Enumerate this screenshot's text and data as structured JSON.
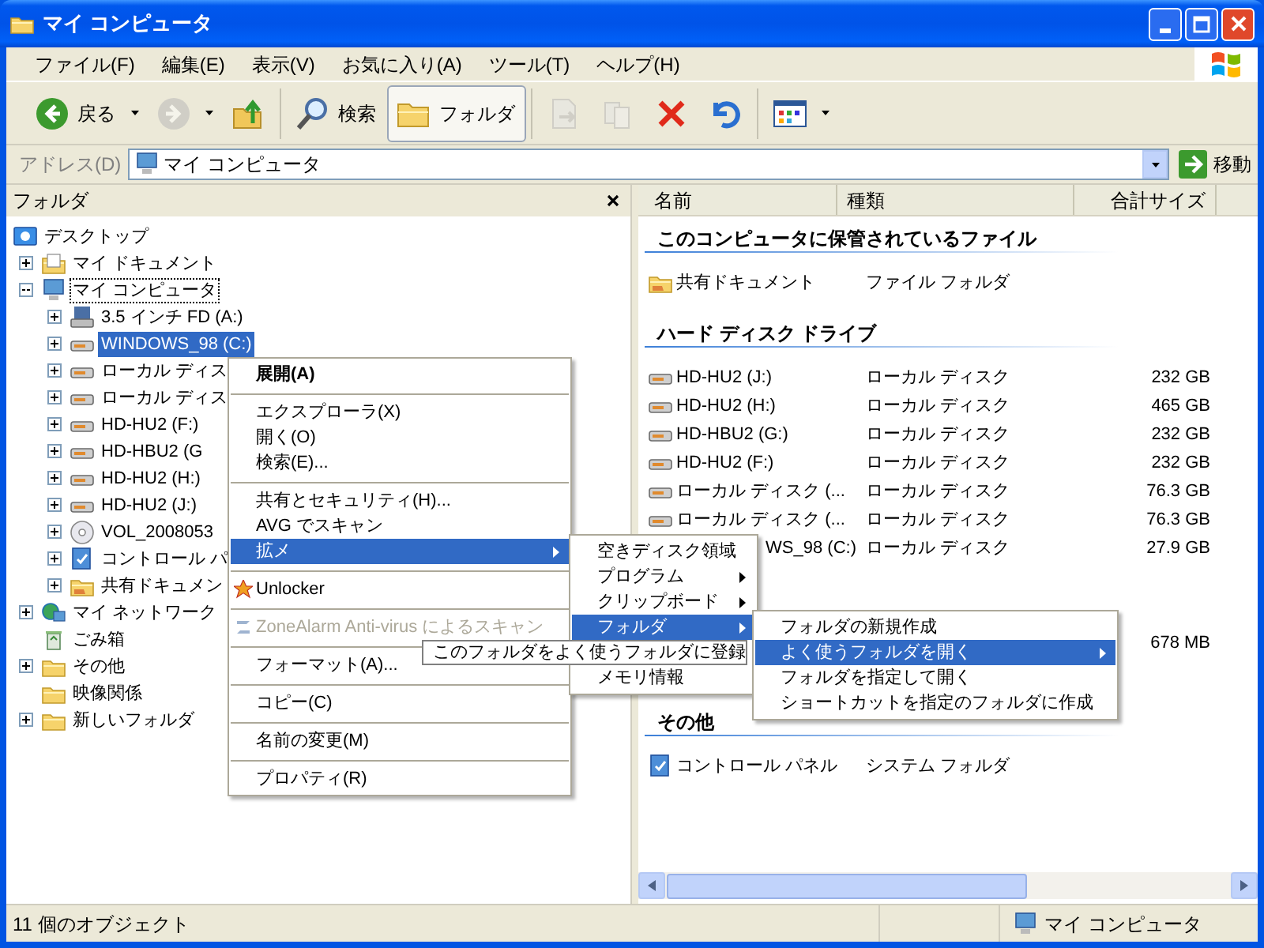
{
  "window": {
    "title": "マイ コンピュータ"
  },
  "menu_bar": [
    "ファイル(F)",
    "編集(E)",
    "表示(V)",
    "お気に入り(A)",
    "ツール(T)",
    "ヘルプ(H)"
  ],
  "toolbar": {
    "groups": [
      [
        {
          "kind": "back",
          "label": "戻る",
          "dropdown": true,
          "disabled": false,
          "selected": false
        },
        {
          "kind": "forward",
          "dropdown": true,
          "disabled": true,
          "selected": false
        },
        {
          "kind": "up",
          "dropdown": false,
          "disabled": false,
          "selected": false
        }
      ],
      [
        {
          "kind": "search",
          "label": "検索",
          "dropdown": false,
          "disabled": false,
          "selected": false
        },
        {
          "kind": "folders",
          "label": "フォルダ",
          "dropdown": false,
          "disabled": false,
          "selected": true
        }
      ],
      [
        {
          "kind": "move",
          "dropdown": false,
          "disabled": true,
          "selected": false
        },
        {
          "kind": "copy",
          "dropdown": false,
          "disabled": true,
          "selected": false
        },
        {
          "kind": "delete",
          "dropdown": false,
          "disabled": false,
          "selected": false
        },
        {
          "kind": "undo",
          "dropdown": false,
          "disabled": false,
          "selected": false
        }
      ],
      [
        {
          "kind": "views",
          "dropdown": true,
          "disabled": false,
          "selected": false
        }
      ]
    ]
  },
  "address": {
    "label": "アドレス(D)",
    "value": "マイ コンピュータ",
    "go_label": "移動"
  },
  "folders_pane": {
    "title": "フォルダ",
    "tree": [
      {
        "label": "デスクトップ",
        "kind": "desktop",
        "selected": false,
        "focused": false,
        "children": [
          {
            "label": "マイ ドキュメント",
            "kind": "documents",
            "expander": true,
            "expanded": false,
            "selected": false,
            "focused": false
          },
          {
            "label": "マイ コンピュータ",
            "kind": "computer",
            "expander": true,
            "expanded": true,
            "selected": false,
            "focused": true,
            "children": [
              {
                "label": "3.5 インチ FD (A:)",
                "kind": "floppy",
                "expander": true,
                "expanded": false,
                "selected": false,
                "focused": false
              },
              {
                "label": "WINDOWS_98 (C:)",
                "kind": "drive",
                "expander": true,
                "expanded": false,
                "selected": true,
                "focused": false
              },
              {
                "label": "ローカル ディス",
                "kind": "drive",
                "expander": true,
                "expanded": false,
                "selected": false,
                "focused": false
              },
              {
                "label": "ローカル ディス",
                "kind": "drive",
                "expander": true,
                "expanded": false,
                "selected": false,
                "focused": false
              },
              {
                "label": "HD-HU2 (F:)",
                "kind": "drive",
                "expander": true,
                "expanded": false,
                "selected": false,
                "focused": false
              },
              {
                "label": "HD-HBU2 (G",
                "kind": "drive",
                "expander": true,
                "expanded": false,
                "selected": false,
                "focused": false
              },
              {
                "label": "HD-HU2 (H:)",
                "kind": "drive",
                "expander": true,
                "expanded": false,
                "selected": false,
                "focused": false
              },
              {
                "label": "HD-HU2 (J:)",
                "kind": "drive",
                "expander": true,
                "expanded": false,
                "selected": false,
                "focused": false
              },
              {
                "label": "VOL_2008053",
                "kind": "cd",
                "expander": true,
                "expanded": false,
                "selected": false,
                "focused": false
              },
              {
                "label": "コントロール パ",
                "kind": "control-panel",
                "expander": true,
                "expanded": false,
                "selected": false,
                "focused": false
              },
              {
                "label": "共有ドキュメン",
                "kind": "shared-folder",
                "expander": true,
                "expanded": false,
                "selected": false,
                "focused": false
              }
            ]
          },
          {
            "label": "マイ ネットワーク",
            "kind": "network",
            "expander": true,
            "expanded": false,
            "selected": false,
            "focused": false
          },
          {
            "label": "ごみ箱",
            "kind": "recycle",
            "expander": false,
            "selected": false,
            "focused": false
          },
          {
            "label": "その他",
            "kind": "folder",
            "expander": true,
            "expanded": false,
            "selected": false,
            "focused": false
          },
          {
            "label": "映像関係",
            "kind": "folder",
            "expander": false,
            "selected": false,
            "focused": false
          },
          {
            "label": "新しいフォルダ",
            "kind": "folder",
            "expander": true,
            "expanded": false,
            "selected": false,
            "focused": false
          }
        ]
      }
    ]
  },
  "list_view": {
    "columns": [
      "名前",
      "種類",
      "合計サイズ"
    ],
    "groups": [
      {
        "title": "このコンピュータに保管されているファイル",
        "items": [
          {
            "kind": "shared-folder",
            "name": "共有ドキュメント",
            "type": "ファイル フォルダ"
          }
        ]
      },
      {
        "title": "ハード ディスク ドライブ",
        "items": [
          {
            "kind": "drive",
            "name": "HD-HU2 (J:)",
            "type": "ローカル ディスク",
            "size": "232 GB"
          },
          {
            "kind": "drive",
            "name": "HD-HU2 (H:)",
            "type": "ローカル ディスク",
            "size": "465 GB"
          },
          {
            "kind": "drive",
            "name": "HD-HBU2 (G:)",
            "type": "ローカル ディスク",
            "size": "232 GB"
          },
          {
            "kind": "drive",
            "name": "HD-HU2 (F:)",
            "type": "ローカル ディスク",
            "size": "232 GB"
          },
          {
            "kind": "drive",
            "name": "ローカル ディスク (...",
            "type": "ローカル ディスク",
            "size": "76.3 GB"
          },
          {
            "kind": "drive",
            "name": "ローカル ディスク (...",
            "type": "ローカル ディスク",
            "size": "76.3 GB"
          },
          {
            "name": "WS_98 (C:)",
            "type": "ローカル ディスク",
            "size": "27.9 GB"
          }
        ]
      },
      {
        "items": [
          {
            "size": "678 MB"
          }
        ]
      },
      {
        "title": "その他",
        "items": [
          {
            "kind": "control-panel",
            "name": "コントロール パネル",
            "type": "システム フォルダ"
          }
        ]
      }
    ]
  },
  "context_menu": {
    "items": [
      {
        "kind": "item",
        "label": "展開(A)",
        "bold": true,
        "selected": false,
        "disabled": false,
        "arrow": false
      },
      {
        "kind": "separator"
      },
      {
        "kind": "item",
        "label": "エクスプローラ(X)",
        "bold": false,
        "selected": false,
        "disabled": false,
        "arrow": false
      },
      {
        "kind": "item",
        "label": "開く(O)",
        "bold": false,
        "selected": false,
        "disabled": false,
        "arrow": false
      },
      {
        "kind": "item",
        "label": "検索(E)...",
        "bold": false,
        "selected": false,
        "disabled": false,
        "arrow": false
      },
      {
        "kind": "separator"
      },
      {
        "kind": "item",
        "label": "共有とセキュリティ(H)...",
        "bold": false,
        "selected": false,
        "disabled": false,
        "arrow": false
      },
      {
        "kind": "item",
        "label": "AVG でスキャン",
        "bold": false,
        "selected": false,
        "disabled": false,
        "arrow": false
      },
      {
        "kind": "item",
        "label": "拡メ",
        "bold": false,
        "selected": true,
        "disabled": false,
        "arrow": true,
        "submenu": [
          {
            "kind": "item",
            "label": "空きディスク領域",
            "selected": false,
            "arrow": false
          },
          {
            "kind": "item",
            "label": "プログラム",
            "selected": false,
            "arrow": true
          },
          {
            "kind": "item",
            "label": "クリップボード",
            "selected": false,
            "arrow": true
          },
          {
            "kind": "item",
            "label": "フォルダ",
            "selected": true,
            "arrow": true,
            "submenu": [
              {
                "kind": "item",
                "label": "フォルダの新規作成",
                "selected": false,
                "arrow": false
              },
              {
                "kind": "item",
                "label": "よく使うフォルダを開く",
                "selected": true,
                "arrow": true
              },
              {
                "kind": "item",
                "label": "フォルダを指定して開く",
                "selected": false,
                "arrow": false
              },
              {
                "kind": "item",
                "label": "ショートカットを指定のフォルダに作成",
                "selected": false,
                "arrow": false
              }
            ]
          },
          {
            "kind": "tooltip",
            "label": "このフォルダをよく使うフォルダに登録"
          },
          {
            "kind": "item",
            "label": "メモリ情報",
            "selected": false,
            "arrow": false
          }
        ]
      },
      {
        "kind": "separator"
      },
      {
        "kind": "icon-item",
        "label": "Unlocker",
        "bold": false,
        "selected": false,
        "disabled": false,
        "arrow": false
      },
      {
        "kind": "separator"
      },
      {
        "kind": "icon-item",
        "label": "ZoneAlarm Anti-virus によるスキャン",
        "bold": false,
        "selected": false,
        "disabled": true,
        "arrow": false
      },
      {
        "kind": "separator"
      },
      {
        "kind": "item",
        "label": "フォーマット(A)...",
        "bold": false,
        "selected": false,
        "disabled": false,
        "arrow": false
      },
      {
        "kind": "separator"
      },
      {
        "kind": "item",
        "label": "コピー(C)",
        "bold": false,
        "selected": false,
        "disabled": false,
        "arrow": false
      },
      {
        "kind": "separator"
      },
      {
        "kind": "item",
        "label": "名前の変更(M)",
        "bold": false,
        "selected": false,
        "disabled": false,
        "arrow": false
      },
      {
        "kind": "separator"
      },
      {
        "kind": "item",
        "label": "プロパティ(R)",
        "bold": false,
        "selected": false,
        "disabled": false,
        "arrow": false
      }
    ]
  },
  "status_bar": {
    "text": "11 個のオブジェクト",
    "zone": "マイ コンピュータ"
  }
}
